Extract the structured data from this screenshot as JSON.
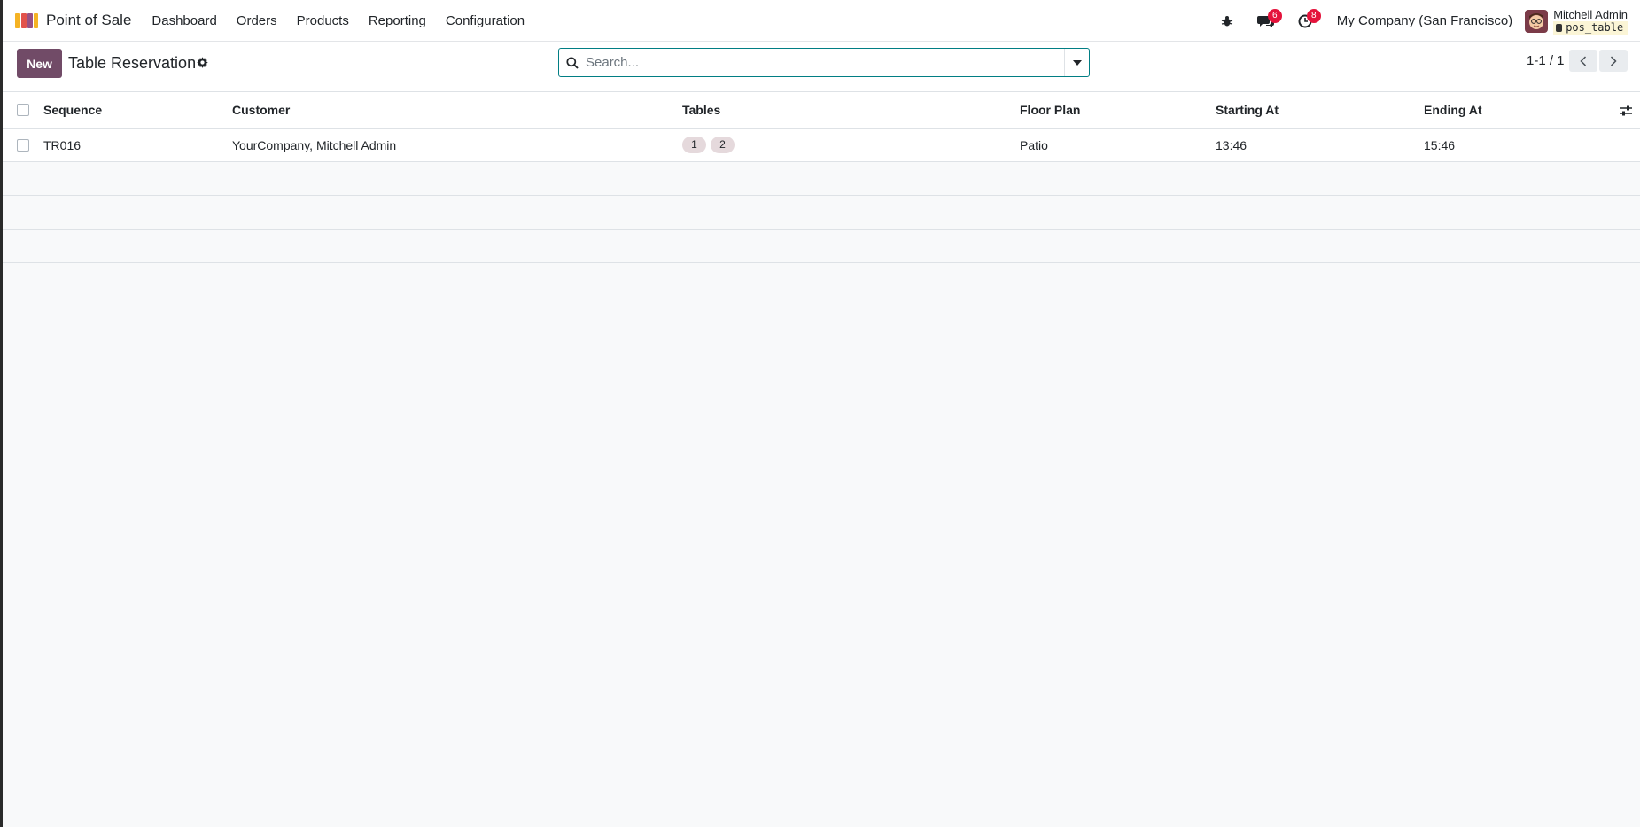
{
  "navbar": {
    "app_name": "Point of Sale",
    "menu": [
      "Dashboard",
      "Orders",
      "Products",
      "Reporting",
      "Configuration"
    ],
    "messages_count": "6",
    "activities_count": "8",
    "company": "My Company (San Francisco)",
    "user_name": "Mitchell Admin",
    "database": "pos_table"
  },
  "control_panel": {
    "new_label": "New",
    "title": "Table Reservation",
    "search_placeholder": "Search...",
    "pager": "1-1 / 1"
  },
  "table": {
    "columns": [
      "Sequence",
      "Customer",
      "Tables",
      "Floor Plan",
      "Starting At",
      "Ending At"
    ],
    "rows": [
      {
        "sequence": "TR016",
        "customer": "YourCompany, Mitchell Admin",
        "tables": [
          "1",
          "2"
        ],
        "floor_plan": "Patio",
        "starting_at": "13:46",
        "ending_at": "15:46"
      }
    ]
  },
  "colors": {
    "primary": "#714b67",
    "accent": "#017e84",
    "badge": "#e4133c",
    "tag_bg": "#e5d9dc"
  },
  "icons": [
    "app-logo-icon",
    "bug-icon",
    "chat-icon",
    "clock-icon",
    "gear-icon",
    "search-icon",
    "caret-down-icon",
    "chevron-left-icon",
    "chevron-right-icon",
    "column-settings-icon"
  ]
}
